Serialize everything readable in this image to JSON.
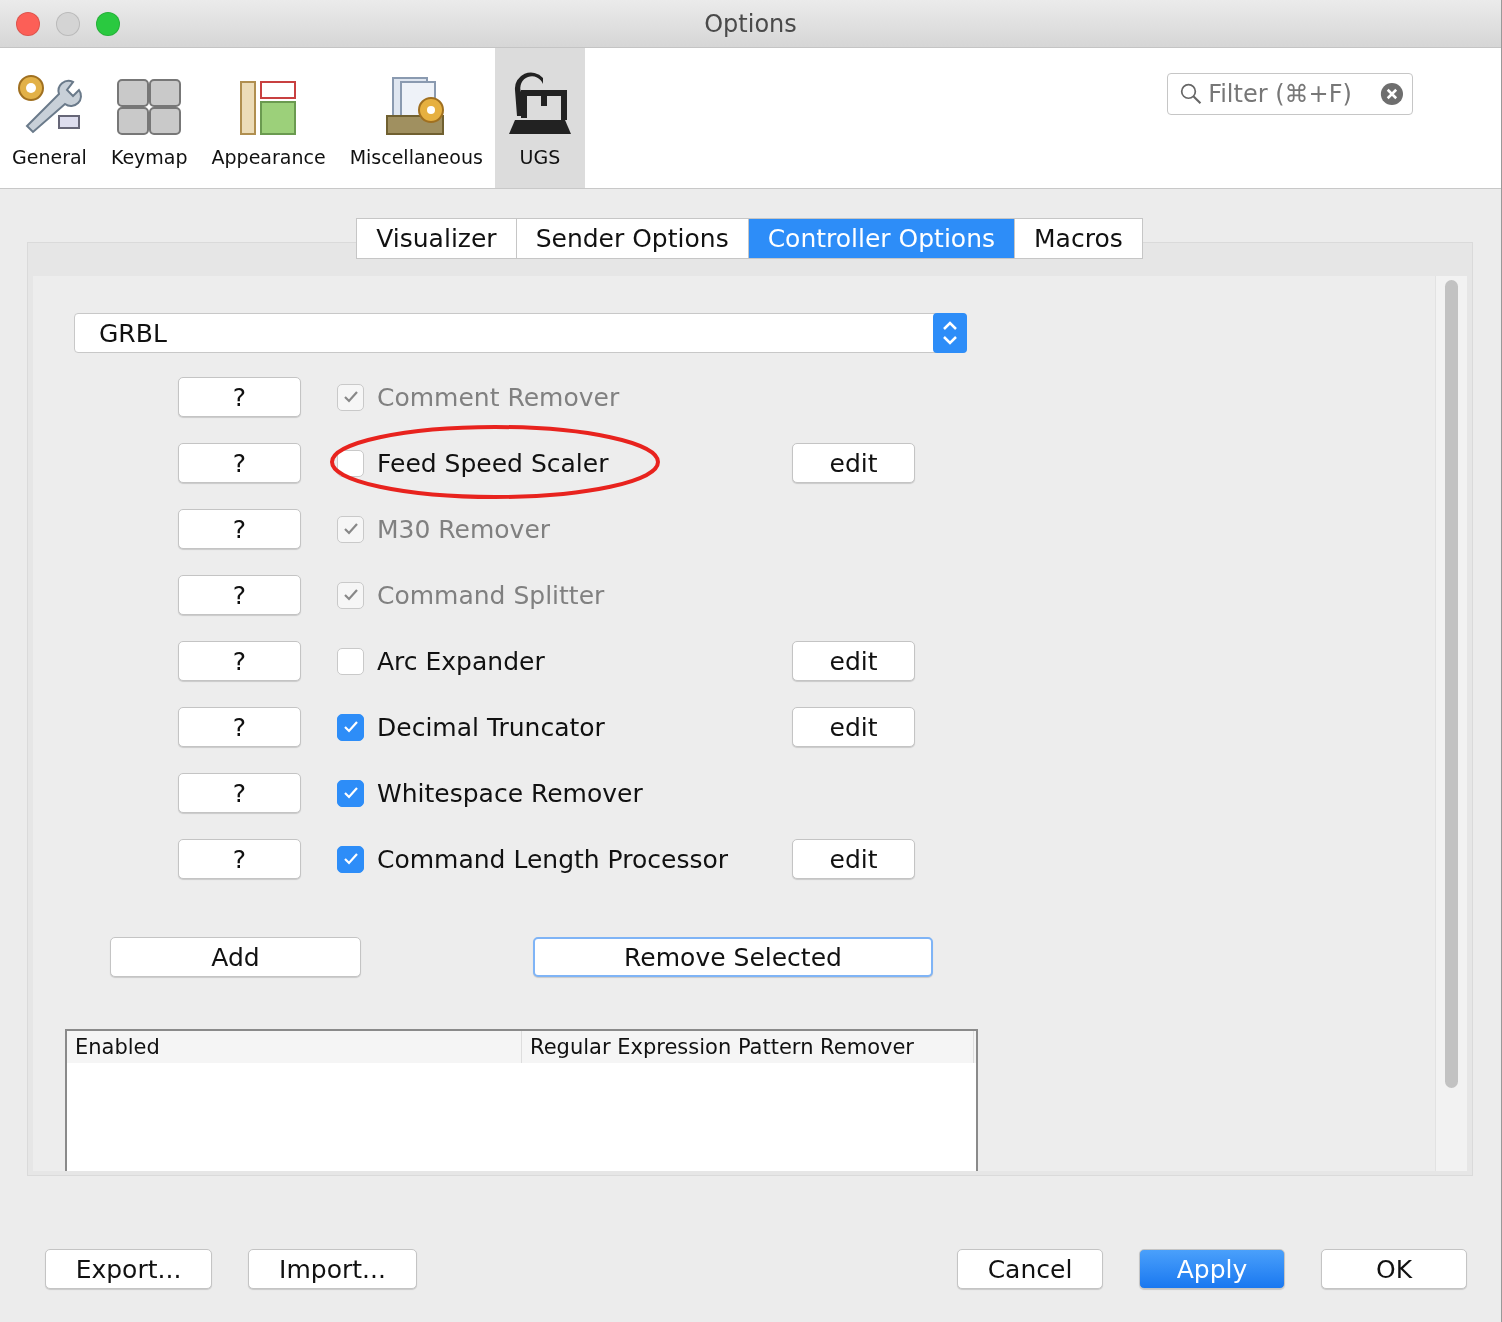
{
  "window": {
    "title": "Options"
  },
  "categories": [
    {
      "label": "General",
      "selected": false
    },
    {
      "label": "Keymap",
      "selected": false
    },
    {
      "label": "Appearance",
      "selected": false
    },
    {
      "label": "Miscellaneous",
      "selected": false
    },
    {
      "label": "UGS",
      "selected": true
    }
  ],
  "filter": {
    "placeholder": "Filter (⌘+F)"
  },
  "tabs": [
    {
      "label": "Visualizer",
      "selected": false
    },
    {
      "label": "Sender Options",
      "selected": false
    },
    {
      "label": "Controller Options",
      "selected": true
    },
    {
      "label": "Macros",
      "selected": false
    }
  ],
  "controller": {
    "value": "GRBL"
  },
  "processors": [
    {
      "help": "?",
      "label": "Comment Remover",
      "checked": true,
      "disabled": true,
      "highlighted": false
    },
    {
      "help": "?",
      "label": "Feed Speed Scaler",
      "checked": false,
      "disabled": false,
      "highlighted": true,
      "edit": "edit"
    },
    {
      "help": "?",
      "label": "M30 Remover",
      "checked": true,
      "disabled": true,
      "highlighted": false
    },
    {
      "help": "?",
      "label": "Command Splitter",
      "checked": true,
      "disabled": true,
      "highlighted": false
    },
    {
      "help": "?",
      "label": "Arc Expander",
      "checked": false,
      "disabled": false,
      "highlighted": false,
      "edit": "edit"
    },
    {
      "help": "?",
      "label": "Decimal Truncator",
      "checked": true,
      "disabled": false,
      "highlighted": false,
      "edit": "edit"
    },
    {
      "help": "?",
      "label": "Whitespace Remover",
      "checked": true,
      "disabled": false,
      "highlighted": false
    },
    {
      "help": "?",
      "label": "Command Length Processor",
      "checked": true,
      "disabled": false,
      "highlighted": false,
      "edit": "edit"
    }
  ],
  "actions": {
    "add": "Add",
    "remove": "Remove Selected"
  },
  "table": {
    "columns": [
      "Enabled",
      "Regular Expression Pattern Remover"
    ]
  },
  "buttons_left": [
    "Export...",
    "Import..."
  ],
  "buttons_right": [
    {
      "label": "Cancel",
      "default": false
    },
    {
      "label": "Apply",
      "default": true
    },
    {
      "label": "OK",
      "default": false
    }
  ]
}
